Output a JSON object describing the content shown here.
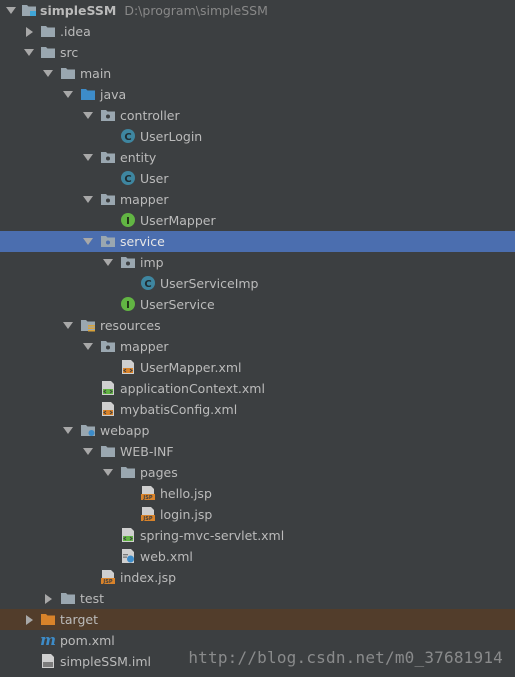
{
  "project": {
    "name": "simpleSSM",
    "path": "D:\\program\\simpleSSM"
  },
  "colors": {
    "background": "#3c3f41",
    "selection": "#4b6eaf",
    "excluded_folder": "#523d2b",
    "text": "#bbbbbb",
    "class_icon": "#3e86a0",
    "interface_icon": "#62b543",
    "jsp_icon": "#d9832a"
  },
  "tree": {
    "idea": ".idea",
    "src": "src",
    "main": "main",
    "java": "java",
    "controller": "controller",
    "UserLogin": "UserLogin",
    "entity": "entity",
    "User": "User",
    "mapper": "mapper",
    "UserMapper": "UserMapper",
    "service": "service",
    "imp": "imp",
    "UserServiceImp": "UserServiceImp",
    "UserService": "UserService",
    "resources": "resources",
    "res_mapper": "mapper",
    "UserMapperXml": "UserMapper.xml",
    "applicationContext": "applicationContext.xml",
    "mybatisConfig": "mybatisConfig.xml",
    "webapp": "webapp",
    "webinf": "WEB-INF",
    "pages": "pages",
    "hello": "hello.jsp",
    "login": "login.jsp",
    "springMvc": "spring-mvc-servlet.xml",
    "webXml": "web.xml",
    "index": "index.jsp",
    "test": "test",
    "target": "target",
    "pom": "pom.xml",
    "iml": "simpleSSM.iml"
  },
  "icon_letters": {
    "class": "C",
    "interface": "I",
    "maven": "m",
    "jsp": "JSP"
  },
  "watermark": "http://blog.csdn.net/m0_37681914"
}
